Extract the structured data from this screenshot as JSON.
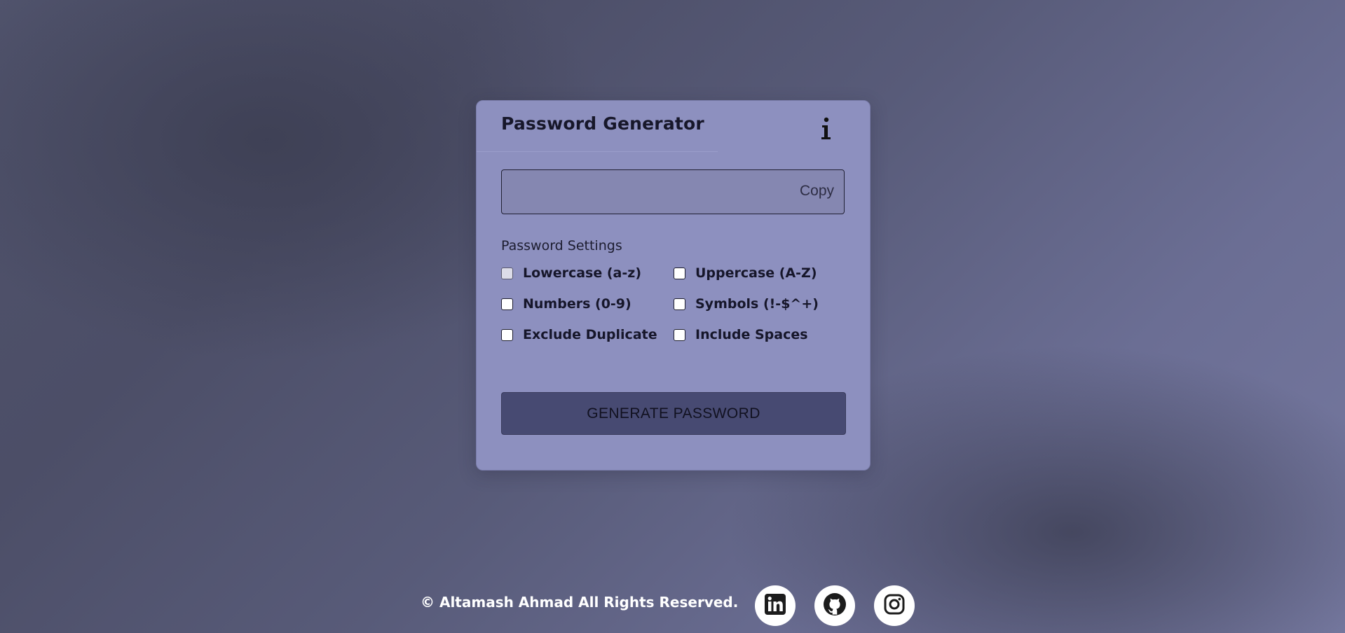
{
  "card": {
    "title": "Password Generator",
    "info_icon": "info-icon"
  },
  "password": {
    "value": "",
    "copy_label": "Copy"
  },
  "settings": {
    "title": "Password Settings",
    "options": [
      {
        "label": "Lowercase (a-z)",
        "checked": false
      },
      {
        "label": "Uppercase (A-Z)",
        "checked": false
      },
      {
        "label": "Numbers (0-9)",
        "checked": false
      },
      {
        "label": "Symbols (!-$^+)",
        "checked": false
      },
      {
        "label": "Exclude Duplicate",
        "checked": false
      },
      {
        "label": "Include Spaces",
        "checked": false
      }
    ]
  },
  "generate_label": "GENERATE PASSWORD",
  "footer": {
    "copyright": "© Altamash Ahmad All Rights Reserved.",
    "socials": [
      {
        "icon": "linkedin-icon"
      },
      {
        "icon": "github-icon"
      },
      {
        "icon": "instagram-icon"
      }
    ]
  },
  "colors": {
    "card": "#8d90bf",
    "button": "#474a72",
    "background_dark": "#4c4e67",
    "background_light": "#7679a0"
  }
}
